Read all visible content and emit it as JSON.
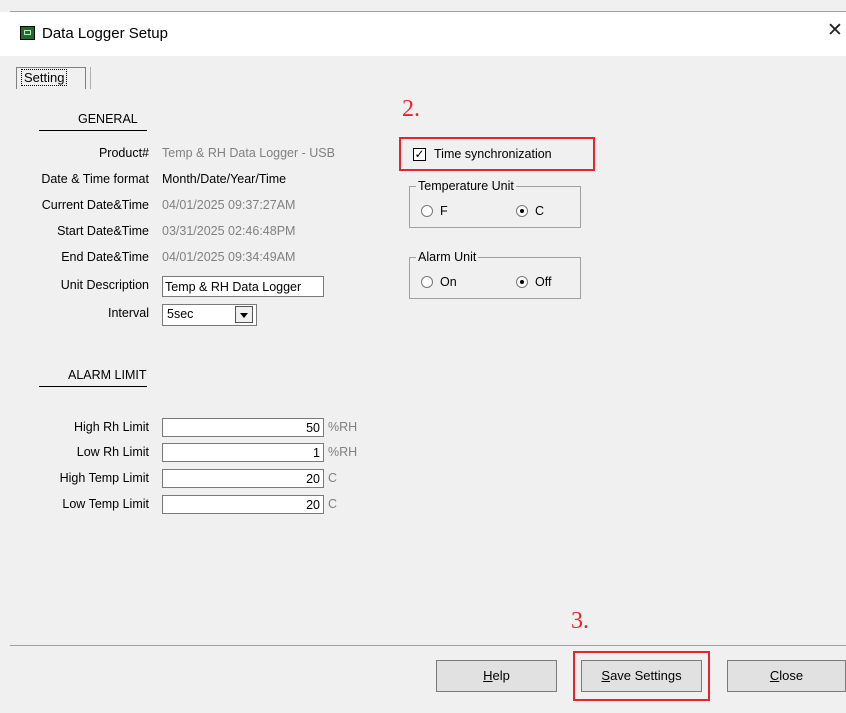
{
  "window": {
    "title": "Data Logger Setup",
    "close_glyph": "✕"
  },
  "tabs": [
    {
      "label": "Setting"
    }
  ],
  "general": {
    "heading": "GENERAL",
    "product_label": "Product#",
    "product_value": "Temp & RH Data Logger - USB",
    "datetime_format_label": "Date & Time format",
    "datetime_format_value": "Month/Date/Year/Time",
    "current_label": "Current Date&Time",
    "current_value": "04/01/2025 09:37:27AM",
    "start_label": "Start Date&Time",
    "start_value": "03/31/2025 02:46:48PM",
    "end_label": "End Date&Time",
    "end_value": "04/01/2025 09:34:49AM",
    "unit_desc_label": "Unit Description",
    "unit_desc_value": "Temp & RH Data Logger",
    "interval_label": "Interval",
    "interval_value": "5sec"
  },
  "alarm_limit": {
    "heading": "ALARM LIMIT",
    "high_rh_label": "High Rh Limit",
    "high_rh_value": "50",
    "high_rh_unit": "%RH",
    "low_rh_label": "Low Rh Limit",
    "low_rh_value": "1",
    "low_rh_unit": "%RH",
    "high_temp_label": "High Temp Limit",
    "high_temp_value": "20",
    "high_temp_unit": "C",
    "low_temp_label": "Low Temp Limit",
    "low_temp_value": "20",
    "low_temp_unit": "C"
  },
  "options": {
    "time_sync_label": "Time synchronization",
    "time_sync_checked": true,
    "check_glyph": "✓",
    "temperature_unit": {
      "title": "Temperature Unit",
      "option_f": "F",
      "option_c": "C",
      "selected": "C"
    },
    "alarm_unit": {
      "title": "Alarm Unit",
      "option_on": "On",
      "option_off": "Off",
      "selected": "Off"
    }
  },
  "annotations": {
    "step2": "2.",
    "step3": "3.",
    "color": "#e4252b"
  },
  "buttons": {
    "help_mnemonic": "H",
    "help_rest": "elp",
    "save_mnemonic": "S",
    "save_rest": "ave Settings",
    "close_mnemonic": "C",
    "close_rest": "lose"
  }
}
